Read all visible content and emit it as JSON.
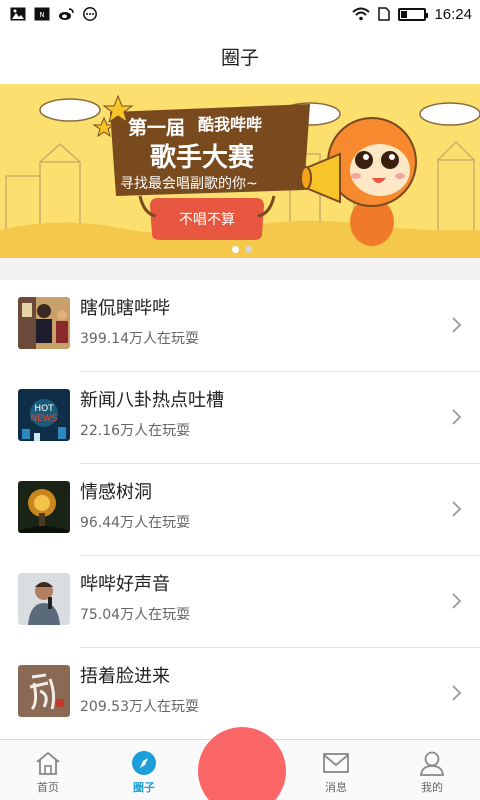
{
  "status": {
    "time": "16:24",
    "left_icons": [
      "image-icon",
      "news-icon",
      "weibo-icon",
      "more-dots-icon"
    ],
    "right_icons": [
      "wifi-icon",
      "sim-icon",
      "battery-icon"
    ]
  },
  "header": {
    "title": "圈子"
  },
  "banner": {
    "line1": "第一届",
    "line2": "酷我哔哔",
    "line3": "歌手大赛",
    "subtitle": "寻找最会唱副歌的你~",
    "button": "不唱不算",
    "active_slide": 0,
    "slide_count": 2
  },
  "list": {
    "items": [
      {
        "title": "瞎侃瞎哔哔",
        "sub": "399.14万人在玩耍",
        "thumb": "people-collage"
      },
      {
        "title": "新闻八卦热点吐槽",
        "sub": "22.16万人在玩耍",
        "thumb": "hot-news"
      },
      {
        "title": "情感树洞",
        "sub": "96.44万人在玩耍",
        "thumb": "glowing-tree"
      },
      {
        "title": "哔哔好声音",
        "sub": "75.04万人在玩耍",
        "thumb": "singer"
      },
      {
        "title": "捂着脸进来",
        "sub": "209.53万人在玩耍",
        "thumb": "calligraphy"
      }
    ]
  },
  "nav": {
    "items": [
      {
        "label": "首页",
        "icon": "home-icon"
      },
      {
        "label": "圈子",
        "icon": "compass-icon",
        "active": true
      },
      {
        "label": "",
        "icon": "record-button"
      },
      {
        "label": "消息",
        "icon": "mail-icon"
      },
      {
        "label": "我的",
        "icon": "person-icon"
      }
    ]
  },
  "colors": {
    "accent": "#1e9ed8",
    "fab": "#fb6767",
    "banner_bg": "#fbe070",
    "banner_title_bg": "#7a4a1f",
    "divider": "#e2e2e2"
  }
}
